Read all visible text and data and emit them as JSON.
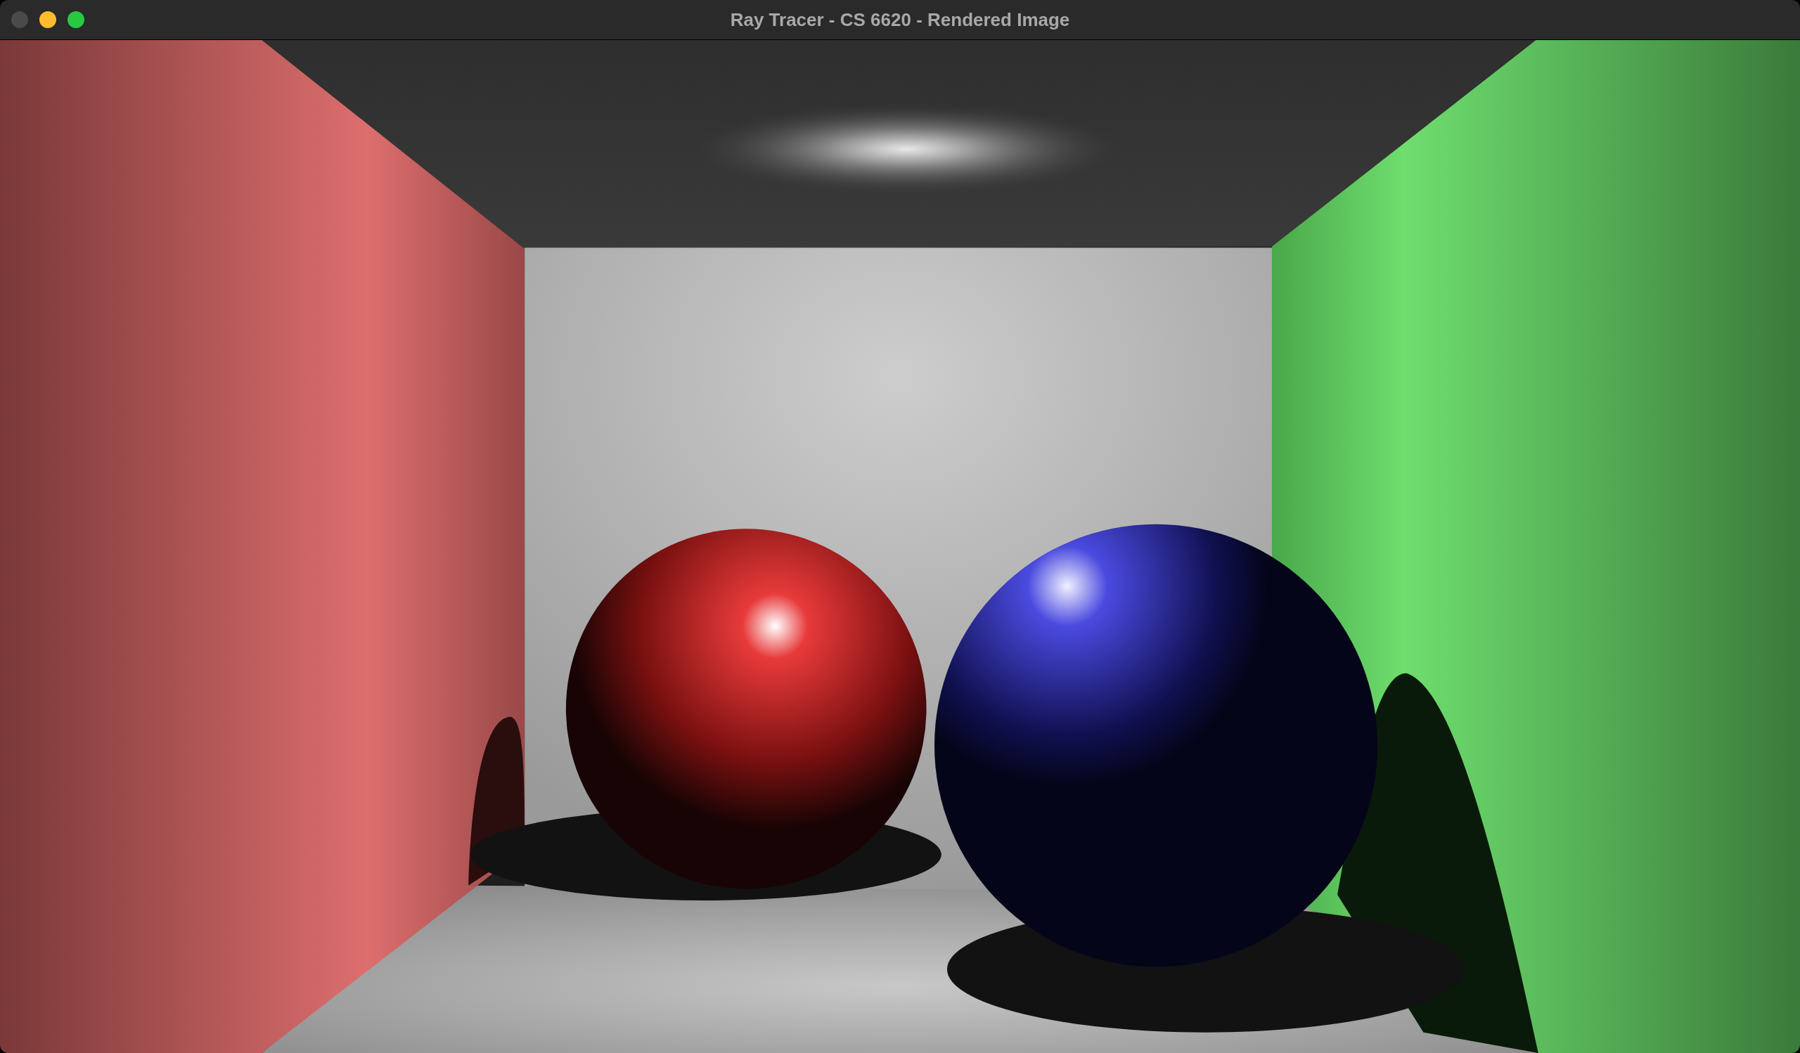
{
  "window": {
    "title": "Ray Tracer - CS 6620 - Rendered Image"
  },
  "window_controls": [
    {
      "kind": "close",
      "disabled": true
    },
    {
      "kind": "minimize",
      "disabled": false
    },
    {
      "kind": "zoom",
      "disabled": false
    }
  ]
}
